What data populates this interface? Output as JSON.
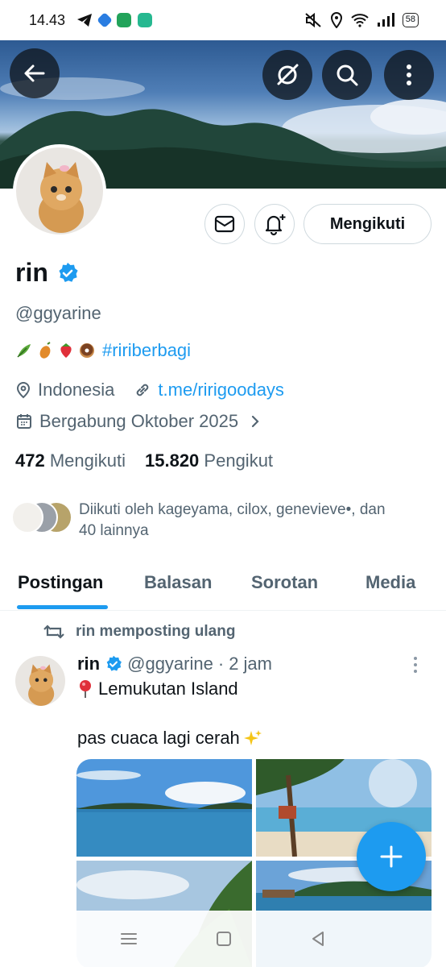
{
  "status_bar": {
    "time": "14.43",
    "battery": "58"
  },
  "profile": {
    "name": "rin",
    "handle": "@ggyarine",
    "bio_emojis": [
      "herb",
      "sweet-potato",
      "strawberry",
      "donut"
    ],
    "bio_hashtag": "#ririberbagi",
    "location": "Indonesia",
    "link": "t.me/ririgoodays",
    "joined": "Bergabung Oktober 2025",
    "following_count": "472",
    "following_label": "Mengikuti",
    "followers_count": "15.820",
    "followers_label": "Pengikut",
    "followed_by_line1": "Diikuti oleh kageyama, cilox, genevieve•, dan",
    "followed_by_line2": "40 lainnya"
  },
  "actions": {
    "follow_label": "Mengikuti"
  },
  "tabs": [
    {
      "label": "Postingan",
      "active": true
    },
    {
      "label": "Balasan",
      "active": false
    },
    {
      "label": "Sorotan",
      "active": false
    },
    {
      "label": "Media",
      "active": false
    }
  ],
  "post": {
    "repost_label": "rin memposting ulang",
    "author_name": "rin",
    "author_handle": "@ggyarine",
    "separator": "·",
    "time": "2 jam",
    "line1": "Lemukutan Island",
    "line2": "pas cuaca lagi cerah"
  },
  "colors": {
    "accent": "#1d9bf0",
    "text_primary": "#0f1419",
    "text_secondary": "#536471",
    "border": "#cfd9de"
  }
}
